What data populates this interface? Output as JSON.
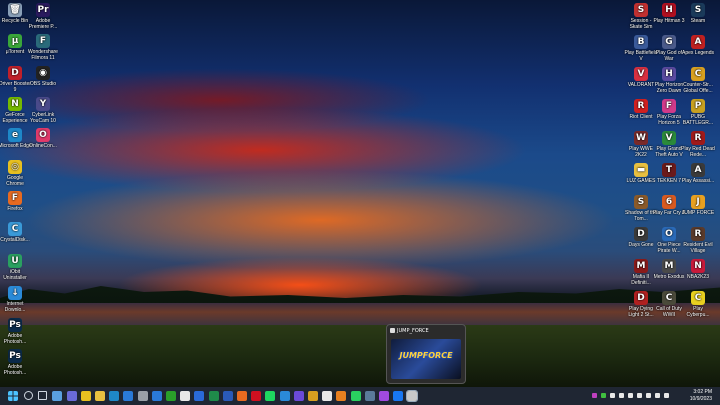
{
  "desktop": {
    "left_icons": [
      {
        "label": "Recycle Bin",
        "icon": "recycle-bin-icon",
        "color": "#8aa0b8",
        "glyph": "🗑"
      },
      {
        "label": "Adobe Premiere P...",
        "icon": "premiere-icon",
        "color": "#2a1a5e",
        "glyph": "Pr"
      },
      {
        "label": "μTorrent",
        "icon": "utorrent-icon",
        "color": "#3aa63a",
        "glyph": "μ"
      },
      {
        "label": "Wondershare Filmora 11",
        "icon": "filmora-icon",
        "color": "#2a6a7a",
        "glyph": "F"
      },
      {
        "label": "Driver Booster 9",
        "icon": "driver-booster-icon",
        "color": "#c0202a",
        "glyph": "D"
      },
      {
        "label": "OBS Studio",
        "icon": "obs-icon",
        "color": "#222222",
        "glyph": "◉"
      },
      {
        "label": "GeForce Experience",
        "icon": "geforce-icon",
        "color": "#76b900",
        "glyph": "N"
      },
      {
        "label": "CyberLink YouCam 10",
        "icon": "youcam-icon",
        "color": "#4a4a8a",
        "glyph": "Y"
      },
      {
        "label": "Microsoft Edge",
        "icon": "edge-icon",
        "color": "#1e88c8",
        "glyph": "e"
      },
      {
        "label": "OnlineCon...",
        "icon": "onlinecon-icon",
        "color": "#e03a6a",
        "glyph": "O"
      },
      {
        "label": "Google Chrome",
        "icon": "chrome-icon",
        "color": "#e8c020",
        "glyph": "◎"
      },
      {
        "label": "Firefox",
        "icon": "firefox-icon",
        "color": "#e86a20",
        "glyph": "F"
      },
      {
        "label": "CrystalDisk...",
        "icon": "crystaldisk-icon",
        "color": "#3a9ad8",
        "glyph": "C"
      },
      {
        "label": "iObit Uninstaller",
        "icon": "iobit-icon",
        "color": "#2aa060",
        "glyph": "U"
      },
      {
        "label": "Internet Downlo...",
        "icon": "idm-icon",
        "color": "#2a8ad8",
        "glyph": "↓"
      },
      {
        "label": "Adobe Photosh...",
        "icon": "photoshop-icon",
        "color": "#0a2a4a",
        "glyph": "Ps"
      },
      {
        "label": "Adobe Photosh...",
        "icon": "photoshop-icon-2",
        "color": "#0a2a4a",
        "glyph": "Ps"
      }
    ],
    "right_icons": [
      {
        "label": "Session - Skate Sim",
        "icon": "session-icon",
        "color": "#c03030",
        "glyph": "S"
      },
      {
        "label": "Play Hitman 3",
        "icon": "hitman-icon",
        "color": "#b01020",
        "glyph": "H"
      },
      {
        "label": "Steam",
        "icon": "steam-icon",
        "color": "#1a3a5a",
        "glyph": "S"
      },
      {
        "label": "Play Battlefield V",
        "icon": "battlefield-icon",
        "color": "#3a5a9a",
        "glyph": "B"
      },
      {
        "label": "Play God of War",
        "icon": "godofwar-icon",
        "color": "#4a5a8a",
        "glyph": "G"
      },
      {
        "label": "Apex Legends",
        "icon": "apex-icon",
        "color": "#c02020",
        "glyph": "A"
      },
      {
        "label": "VALORANT",
        "icon": "valorant-icon",
        "color": "#d83040",
        "glyph": "V"
      },
      {
        "label": "Play Horizon Zero Dawn",
        "icon": "horizon-icon",
        "color": "#5a4aa0",
        "glyph": "H"
      },
      {
        "label": "Counter-Str... Global Offe...",
        "icon": "csgo-icon",
        "color": "#d8a020",
        "glyph": "C"
      },
      {
        "label": "Riot Client",
        "icon": "riot-icon",
        "color": "#d02020",
        "glyph": "R"
      },
      {
        "label": "Play Forza Horizon 5",
        "icon": "forza-icon",
        "color": "#d03a8a",
        "glyph": "F"
      },
      {
        "label": "PUBG BATTLEGR...",
        "icon": "pubg-icon",
        "color": "#c8a020",
        "glyph": "P"
      },
      {
        "label": "Play WWE 2K22",
        "icon": "wwe-icon",
        "color": "#7a2a2a",
        "glyph": "W"
      },
      {
        "label": "Play Grand Theft Auto V",
        "icon": "gta-icon",
        "color": "#2a8a3a",
        "glyph": "V"
      },
      {
        "label": "Play Red Dead Rede...",
        "icon": "rdr-icon",
        "color": "#a01a1a",
        "glyph": "R"
      },
      {
        "label": "LUZ GAMES",
        "icon": "folder-icon",
        "color": "#e8c040",
        "glyph": "▬"
      },
      {
        "label": "TEKKEN 7",
        "icon": "tekken-icon",
        "color": "#6a1a1a",
        "glyph": "T"
      },
      {
        "label": "Play Assassi...",
        "icon": "assassin-icon",
        "color": "#3a3a3a",
        "glyph": "A"
      },
      {
        "label": "Shadow of the Tom...",
        "icon": "tombraider-icon",
        "color": "#8a5a2a",
        "glyph": "S"
      },
      {
        "label": "Play Far Cry 6",
        "icon": "farcry-icon",
        "color": "#d85a20",
        "glyph": "6"
      },
      {
        "label": "JUMP FORCE",
        "icon": "jumpforce-icon",
        "color": "#e8a020",
        "glyph": "J"
      },
      {
        "label": "Days Gone",
        "icon": "daysgone-icon",
        "color": "#3a3a3a",
        "glyph": "D"
      },
      {
        "label": "One Piece Pirate W...",
        "icon": "onepiece-icon",
        "color": "#2a6ab8",
        "glyph": "O"
      },
      {
        "label": "Resident Evil Village",
        "icon": "residentevil-icon",
        "color": "#5a3a2a",
        "glyph": "R"
      },
      {
        "label": "Mafia II Definiti...",
        "icon": "mafia-icon",
        "color": "#8a1a1a",
        "glyph": "M"
      },
      {
        "label": "Metro Exodus",
        "icon": "metro-icon",
        "color": "#4a4a4a",
        "glyph": "M"
      },
      {
        "label": "NBA2K23",
        "icon": "nba-icon",
        "color": "#c81a3a",
        "glyph": "N"
      },
      {
        "label": "Play Dying Light 2 St...",
        "icon": "dyinglight-icon",
        "color": "#b02020",
        "glyph": "D"
      },
      {
        "label": "Call of Duty WWII",
        "icon": "cod-icon",
        "color": "#4a4a3a",
        "glyph": "C"
      },
      {
        "label": "Play Cyberpu...",
        "icon": "cyberpunk-icon",
        "color": "#e8d020",
        "glyph": "C"
      }
    ]
  },
  "preview": {
    "title": "JUMP_FORCE",
    "logo_text": "JUMPFORCE"
  },
  "taskbar": {
    "time": "3:02 PM",
    "date": "10/9/2023",
    "apps": [
      {
        "icon": "search-icon",
        "color": "#cfd6e0"
      },
      {
        "icon": "task-view-icon",
        "color": "#cfd6e0"
      },
      {
        "icon": "widgets-icon",
        "color": "#5aa0e0"
      },
      {
        "icon": "teams-icon",
        "color": "#6a6ad8"
      },
      {
        "icon": "chrome-taskbar-icon",
        "color": "#e8c020"
      },
      {
        "icon": "file-explorer-icon",
        "color": "#e8c040"
      },
      {
        "icon": "edge-taskbar-icon",
        "color": "#1e88c8"
      },
      {
        "icon": "mail-icon",
        "color": "#2a7ad8"
      },
      {
        "icon": "camera-icon",
        "color": "#9aa0a8"
      },
      {
        "icon": "calendar-icon",
        "color": "#2a7ad8"
      },
      {
        "icon": "xbox-icon",
        "color": "#2aa02a"
      },
      {
        "icon": "store-icon",
        "color": "#e8e8e8"
      },
      {
        "icon": "todo-icon",
        "color": "#2a6ad8"
      },
      {
        "icon": "excel-icon",
        "color": "#1f8a4a"
      },
      {
        "icon": "word-icon",
        "color": "#2a5ab8"
      },
      {
        "icon": "firefox-taskbar-icon",
        "color": "#e86a20"
      },
      {
        "icon": "netflix-icon",
        "color": "#d01020"
      },
      {
        "icon": "spotify-icon",
        "color": "#1ed760"
      },
      {
        "icon": "photoshop-taskbar-icon",
        "color": "#2a8ad8"
      },
      {
        "icon": "premiere-taskbar-icon",
        "color": "#6a4ad8"
      },
      {
        "icon": "chrome-taskbar-icon-2",
        "color": "#d8a020"
      },
      {
        "icon": "tiktok-icon",
        "color": "#e8e8e8"
      },
      {
        "icon": "vlc-icon",
        "color": "#e88020"
      },
      {
        "icon": "whatsapp-icon",
        "color": "#2ad060"
      },
      {
        "icon": "steam-taskbar-icon",
        "color": "#5a7a9a"
      },
      {
        "icon": "messenger-icon",
        "color": "#a04ae0"
      },
      {
        "icon": "facebook-icon",
        "color": "#1877f2"
      },
      {
        "icon": "game-taskbar-icon",
        "color": "#c8c8c8"
      }
    ]
  }
}
